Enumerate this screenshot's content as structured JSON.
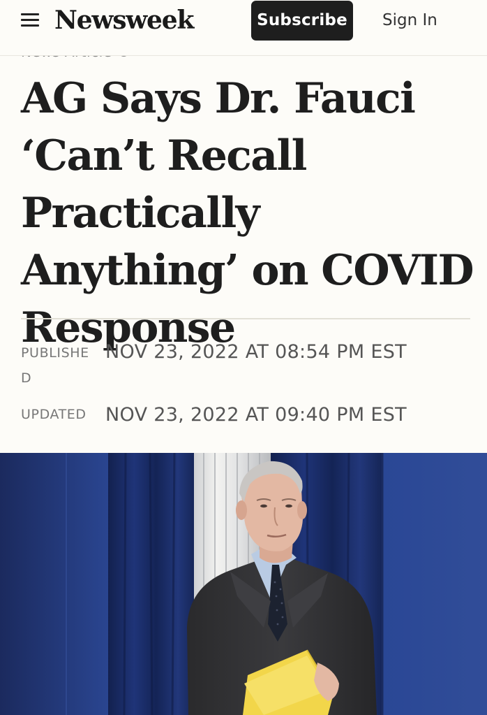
{
  "header": {
    "logo": "Newsweek",
    "subscribe_label": "Subscribe",
    "signin_label": "Sign In"
  },
  "article": {
    "kicker": "News Article ©",
    "headline": "AG Says Dr. Fauci ‘Can’t Recall Practically Anything’ on COVID Response",
    "published_label": "PUBLISHED",
    "published_value": "NOV 23, 2022 AT 08:54 PM EST",
    "updated_label": "UPDATED",
    "updated_value": "NOV 23, 2022 AT 09:40 PM EST"
  },
  "colors": {
    "page_bg": "#fdfcf8",
    "subscribe_bg": "#1e1e1e",
    "text_dark": "#1e1e1e",
    "meta_gray": "#777777",
    "curtain_blue": "#1d2f6e",
    "folder_yellow": "#f2d64a"
  },
  "icons": {
    "menu": "hamburger-menu-icon"
  }
}
